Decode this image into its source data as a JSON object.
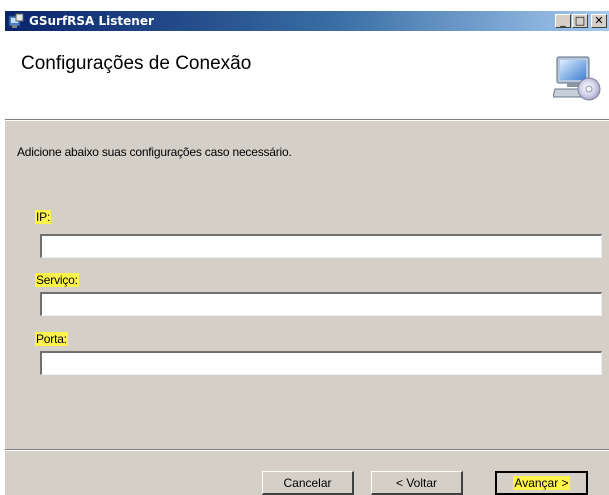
{
  "window": {
    "title": "GSurfRSA Listener",
    "controls": {
      "minimize": "_",
      "maximize": "□",
      "close": "✕"
    }
  },
  "header": {
    "title": "Configurações de Conexão",
    "icon": "computer-cd-icon"
  },
  "body": {
    "instruction": "Adicione abaixo suas configurações caso necessário.",
    "fields": [
      {
        "label": "IP:",
        "value": ""
      },
      {
        "label": "Serviço:",
        "value": ""
      },
      {
        "label": "Porta:",
        "value": ""
      }
    ]
  },
  "buttons": {
    "cancel": "Cancelar",
    "back": "< Voltar",
    "next": "Avançar >"
  },
  "colors": {
    "highlight": "#fdf34a",
    "title_bar_start": "#0a246a",
    "title_bar_end": "#a6caf0",
    "dialog_face": "#d4d0c8"
  }
}
